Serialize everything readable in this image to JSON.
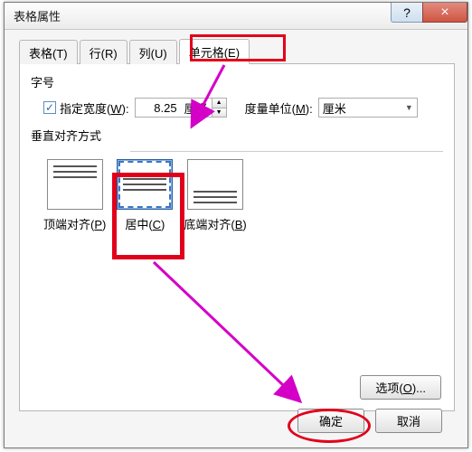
{
  "window_title": "表格属性",
  "help_glyph": "?",
  "close_glyph": "×",
  "tabs": {
    "t0": "表格(T)",
    "t1": "行(R)",
    "t2": "列(U)",
    "t3": "单元格(E)"
  },
  "size": {
    "section": "字号",
    "checkbox_label_prefix": "指定宽度(",
    "checkbox_key": "W",
    "checkbox_label_suffix": "):",
    "checked": true,
    "width_value": "8.25",
    "width_unit": "厘米",
    "measure_label_prefix": "度量单位(",
    "measure_key": "M",
    "measure_label_suffix": "):",
    "measure_value": "厘米"
  },
  "align": {
    "section": "垂直对齐方式",
    "top_prefix": "顶端对齐(",
    "top_key": "P",
    "top_suffix": ")",
    "center_prefix": "居中(",
    "center_key": "C",
    "center_suffix": ")",
    "bottom_prefix": "底端对齐(",
    "bottom_key": "B",
    "bottom_suffix": ")"
  },
  "options_prefix": "选项(",
  "options_key": "O",
  "options_suffix": ")...",
  "ok_label": "确定",
  "cancel_label": "取消"
}
